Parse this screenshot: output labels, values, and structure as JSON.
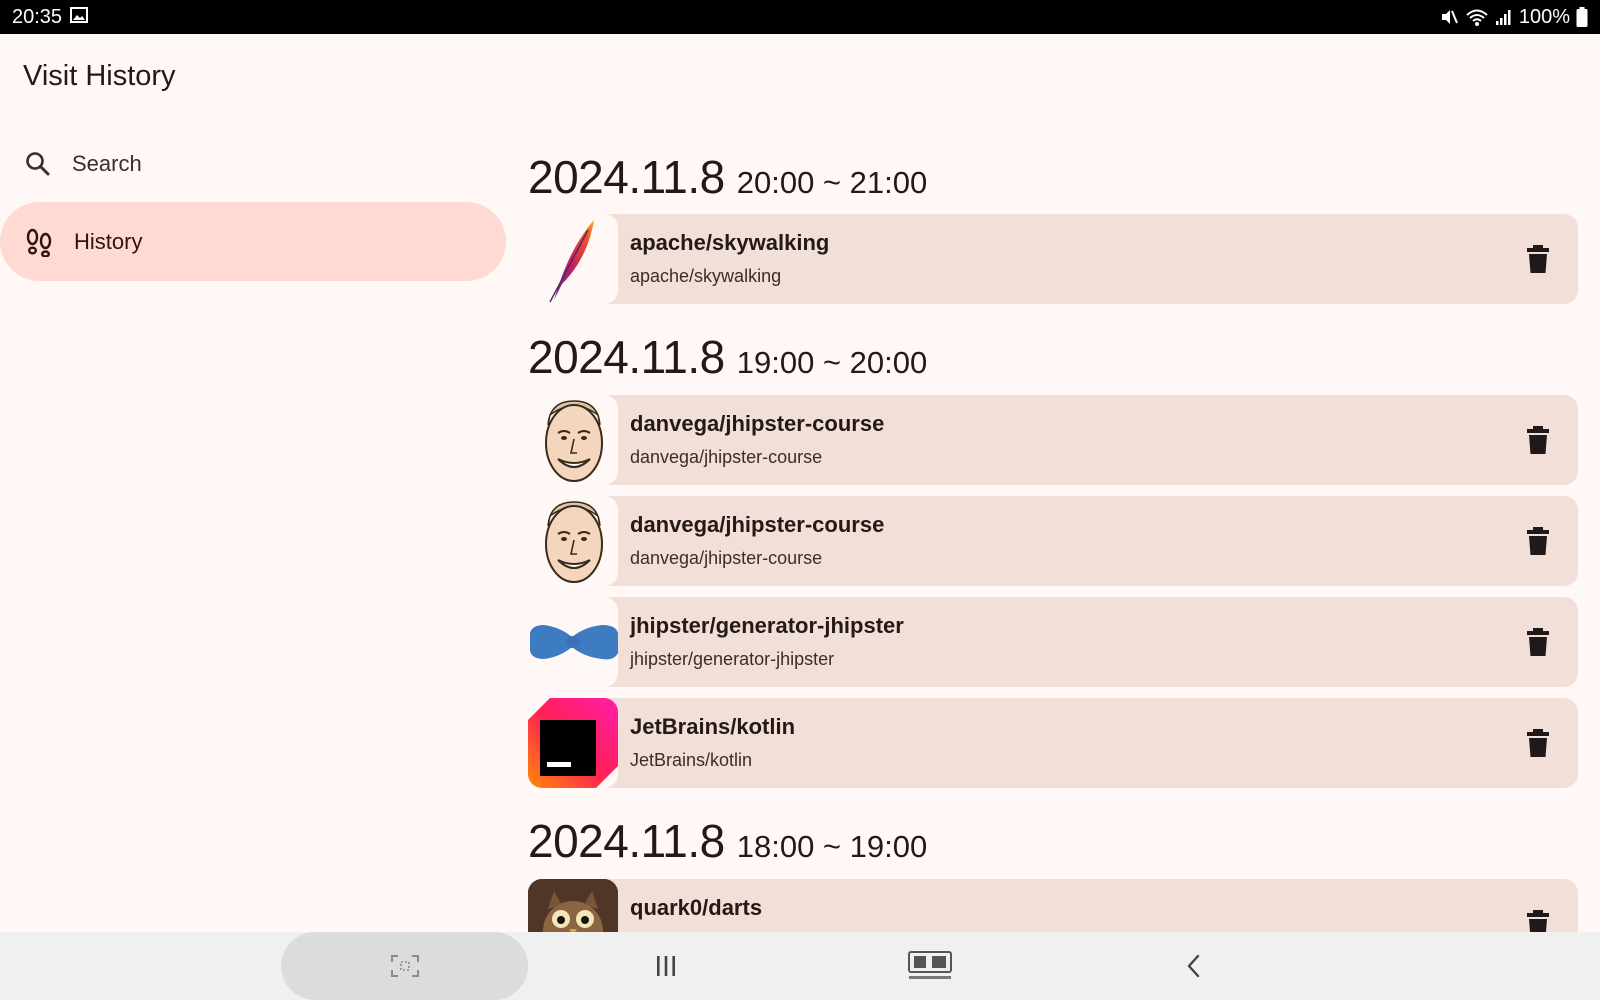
{
  "status_bar": {
    "time": "20:35",
    "battery": "100%"
  },
  "app": {
    "title": "Visit History"
  },
  "nav": {
    "search_label": "Search",
    "history_label": "History"
  },
  "groups": [
    {
      "date": "2024.11.8",
      "range": "20:00 ~ 21:00",
      "items": [
        {
          "title": "apache/skywalking",
          "subtitle": "apache/skywalking",
          "icon": "apache-feather-icon"
        }
      ]
    },
    {
      "date": "2024.11.8",
      "range": "19:00 ~ 20:00",
      "items": [
        {
          "title": "danvega/jhipster-course",
          "subtitle": "danvega/jhipster-course",
          "icon": "caricature-face-icon"
        },
        {
          "title": "danvega/jhipster-course",
          "subtitle": "danvega/jhipster-course",
          "icon": "caricature-face-icon"
        },
        {
          "title": "jhipster/generator-jhipster",
          "subtitle": "jhipster/generator-jhipster",
          "icon": "jhipster-bowtie-icon"
        },
        {
          "title": "JetBrains/kotlin",
          "subtitle": "JetBrains/kotlin",
          "icon": "jetbrains-logo-icon"
        }
      ]
    },
    {
      "date": "2024.11.8",
      "range": "18:00 ~ 19:00",
      "items": [
        {
          "title": "quark0/darts",
          "subtitle": "",
          "icon": "owl-avatar-icon"
        }
      ]
    }
  ],
  "colors": {
    "background": "#fff8f6",
    "card": "#f2dfd8",
    "nav_active": "#ffdad2",
    "status_bar": "#000000",
    "system_nav": "#f0f0f0"
  }
}
